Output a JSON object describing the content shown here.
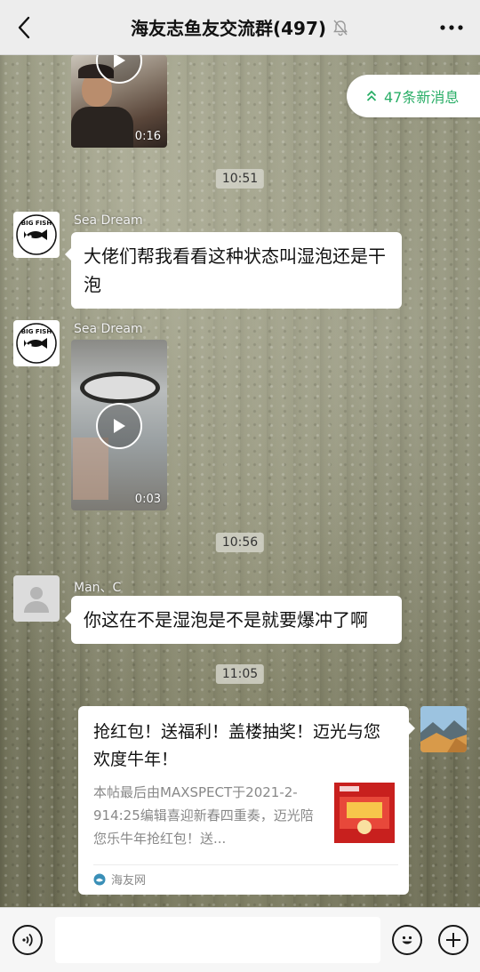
{
  "header": {
    "title": "海友志鱼友交流群(497)",
    "back_icon": "chevron-left-icon",
    "mute_icon": "bell-off-icon",
    "more_icon": "more-dots-icon"
  },
  "new_messages": {
    "label": "47条新消息",
    "icon": "double-chevron-up-icon",
    "color": "#2aae67"
  },
  "messages": [
    {
      "type": "video",
      "duration": "0:16"
    },
    {
      "type": "time",
      "text": "10:51"
    },
    {
      "type": "text",
      "sender": "Sea Dream",
      "avatar": "big-fish-logo",
      "text": "大佬们帮我看看这种状态叫湿泡还是干泡"
    },
    {
      "type": "video",
      "sender": "Sea Dream",
      "avatar": "big-fish-logo",
      "duration": "0:03"
    },
    {
      "type": "time",
      "text": "10:56"
    },
    {
      "type": "text",
      "sender": "Man、C",
      "avatar": "default-avatar",
      "text": "你这在不是湿泡是不是就要爆冲了啊"
    },
    {
      "type": "time",
      "text": "11:05"
    },
    {
      "type": "link-card",
      "title": "抢红包！送福利！盖楼抽奖！迈光与您欢度牛年！",
      "description": "本帖最后由MAXSPECT于2021-2-914:25编辑喜迎新春四重奏，迈光陪您乐牛年抢红包！送...",
      "source": "海友网"
    }
  ],
  "avatars": {
    "big_fish_logo_text": "BIG FISH"
  },
  "input_bar": {
    "voice_icon": "voice-icon",
    "emoji_icon": "emoji-icon",
    "plus_icon": "plus-icon",
    "value": ""
  }
}
